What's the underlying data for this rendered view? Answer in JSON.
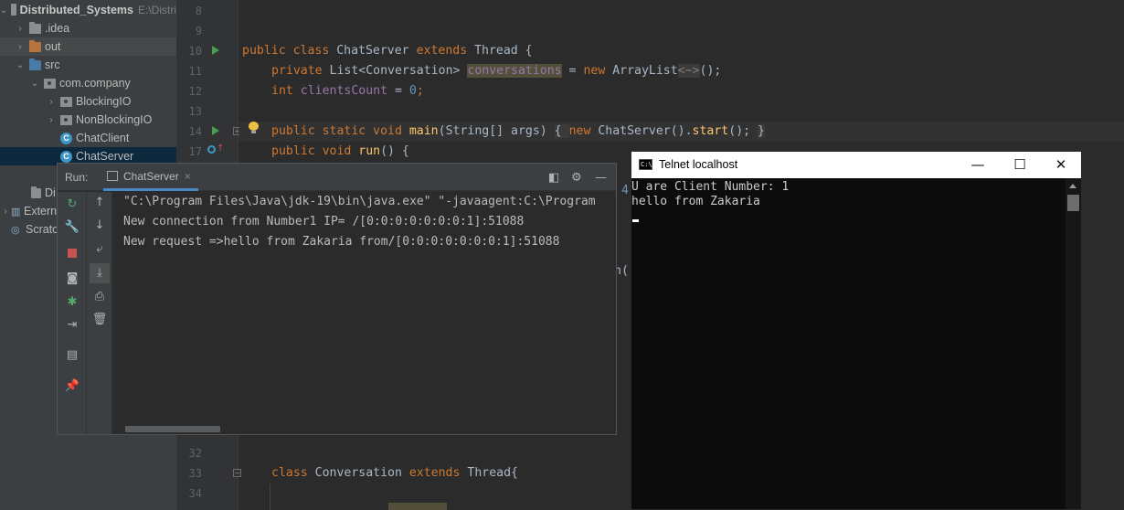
{
  "project_tree": {
    "items": [
      {
        "name": "Distributed_Systems",
        "path": "E:\\Distri",
        "bold": true
      },
      {
        "name": ".idea"
      },
      {
        "name": "out"
      },
      {
        "name": "src"
      },
      {
        "name": "com.company"
      },
      {
        "name": "BlockingIO"
      },
      {
        "name": "NonBlockingIO"
      },
      {
        "name": "ChatClient"
      },
      {
        "name": "ChatServer"
      },
      {
        "name": "Di"
      },
      {
        "name": "Extern"
      },
      {
        "name": "Scrato"
      }
    ]
  },
  "editor": {
    "line_numbers": [
      "8",
      "9",
      "10",
      "11",
      "12",
      "13",
      "14",
      "17",
      "32",
      "33",
      "34"
    ],
    "code": {
      "l10": {
        "kw1": "public class ",
        "name": "ChatServer ",
        "kw2": "extends ",
        "rest": "Thread {"
      },
      "l11": {
        "kw": "private ",
        "type": "List<Conversation> ",
        "field": "conversations",
        "eq": " = ",
        "new": "new ",
        "cls": "ArrayList",
        "diamond": "<~>",
        "end": "();"
      },
      "l12": {
        "kw": "int ",
        "field": "clientsCount",
        "eq": " = ",
        "num": "0",
        "end": ";"
      },
      "l14": {
        "kw": "public static void ",
        "fn": "main",
        "args": "(String[] args) ",
        "brace1": "{ ",
        "new": "new ",
        "cls": "ChatServer().",
        "fn2": "start",
        "end": "(); ",
        "brace2": "}"
      },
      "l17": {
        "kw": "public void ",
        "fn": "run",
        "end": "() {"
      },
      "frag_4": "4",
      "frag_n": "n(",
      "l33": {
        "kw": "class ",
        "name": "Conversation ",
        "kw2": "extends ",
        "rest": "Thread{"
      }
    }
  },
  "run_panel": {
    "title": "Run:",
    "tab_label": "ChatServer",
    "tab_close": "×",
    "console_lines": [
      "\"C:\\Program Files\\Java\\jdk-19\\bin\\java.exe\" \"-javaagent:C:\\Program",
      "New connection from Number1 IP= /[0:0:0:0:0:0:0:1]:51088",
      "New request =>hello from Zakaria from/[0:0:0:0:0:0:0:1]:51088"
    ]
  },
  "telnet": {
    "title": "Telnet localhost",
    "icon_text": "C:\\",
    "lines": [
      "U are Client Number: 1",
      "hello from Zakaria"
    ]
  }
}
